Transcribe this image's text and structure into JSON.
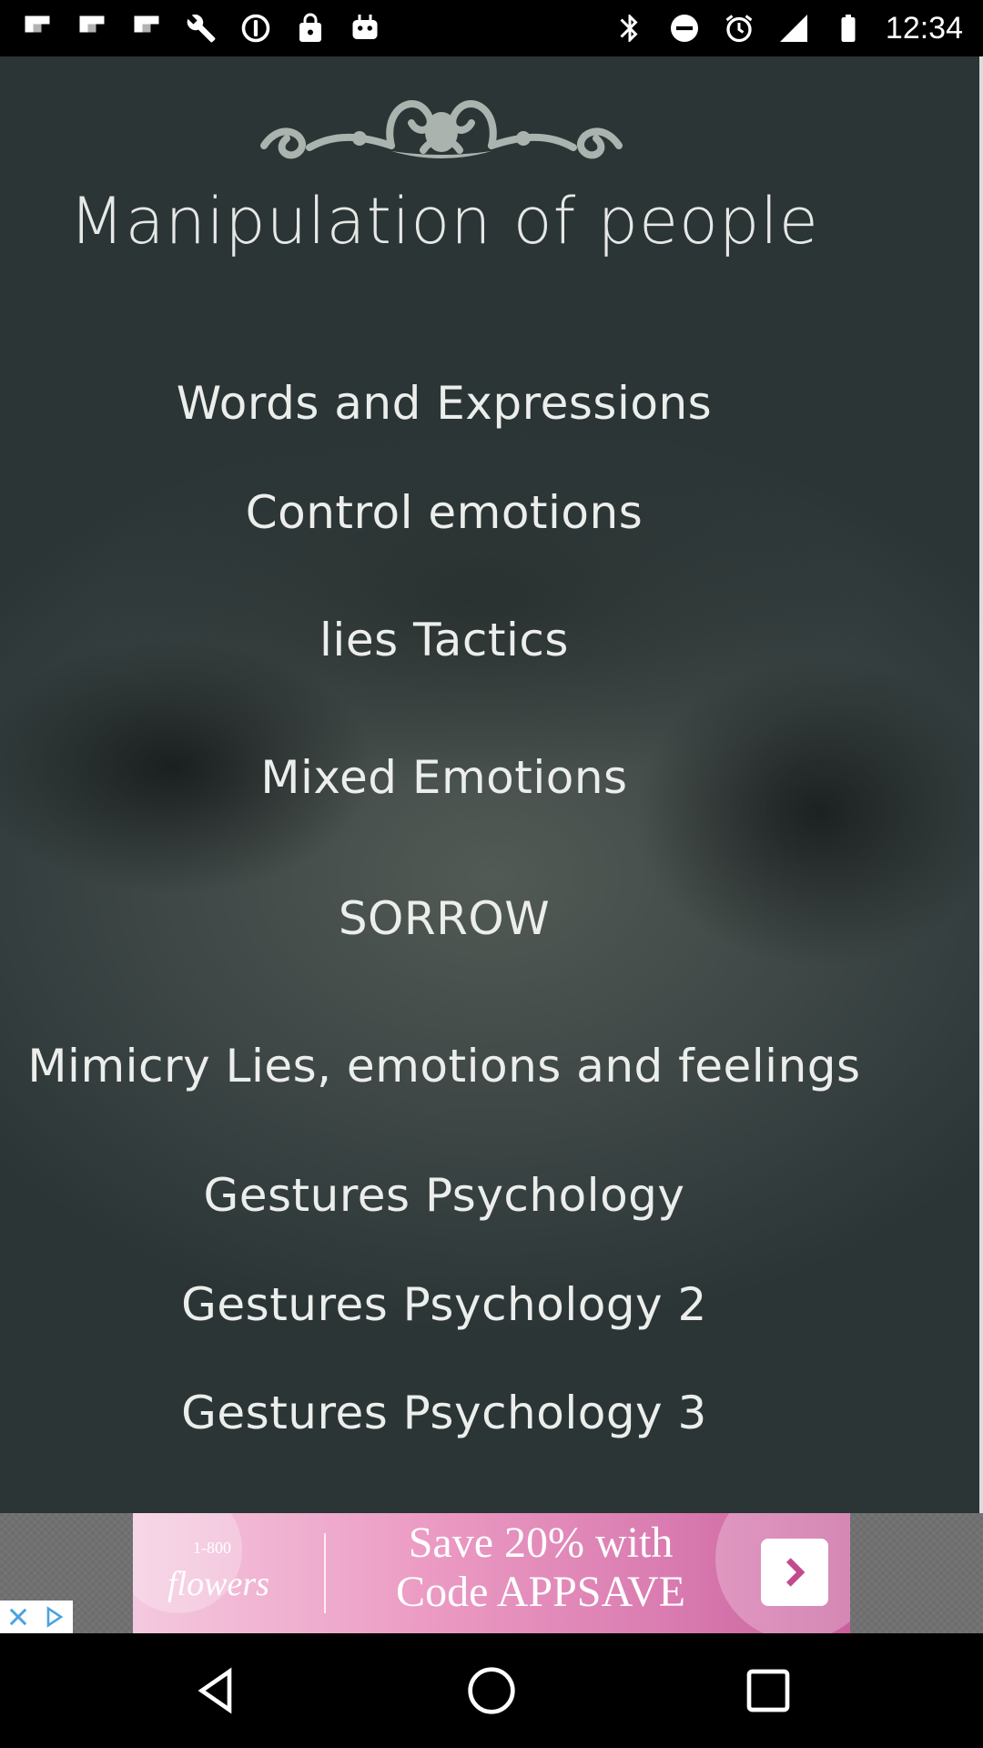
{
  "status_bar": {
    "time": "12:34",
    "left_icons": [
      "flipboard-icon",
      "flipboard-icon",
      "flipboard-icon",
      "wrench-icon",
      "settings-icon",
      "lock-icon",
      "robot-icon"
    ],
    "right_icons": [
      "bluetooth-icon",
      "do-not-disturb-icon",
      "alarm-icon",
      "signal-icon",
      "battery-icon"
    ]
  },
  "app": {
    "title": "Manipulation of people",
    "menu": [
      {
        "label": "Words and Expressions"
      },
      {
        "label": "Control emotions"
      },
      {
        "label": "lies Tactics"
      },
      {
        "label": "Mixed Emotions"
      },
      {
        "label": "SORROW"
      },
      {
        "label": "Mimicry Lies, emotions and feelings"
      },
      {
        "label": "Gestures Psychology"
      },
      {
        "label": "Gestures Psychology 2"
      },
      {
        "label": "Gestures Psychology 3"
      }
    ]
  },
  "ad": {
    "brand_number": "1-800",
    "brand": "flowers",
    "line1": "Save 20% with",
    "line2": "Code APPSAVE"
  },
  "nav": {
    "back": "back-icon",
    "home": "home-icon",
    "recents": "recents-icon"
  }
}
